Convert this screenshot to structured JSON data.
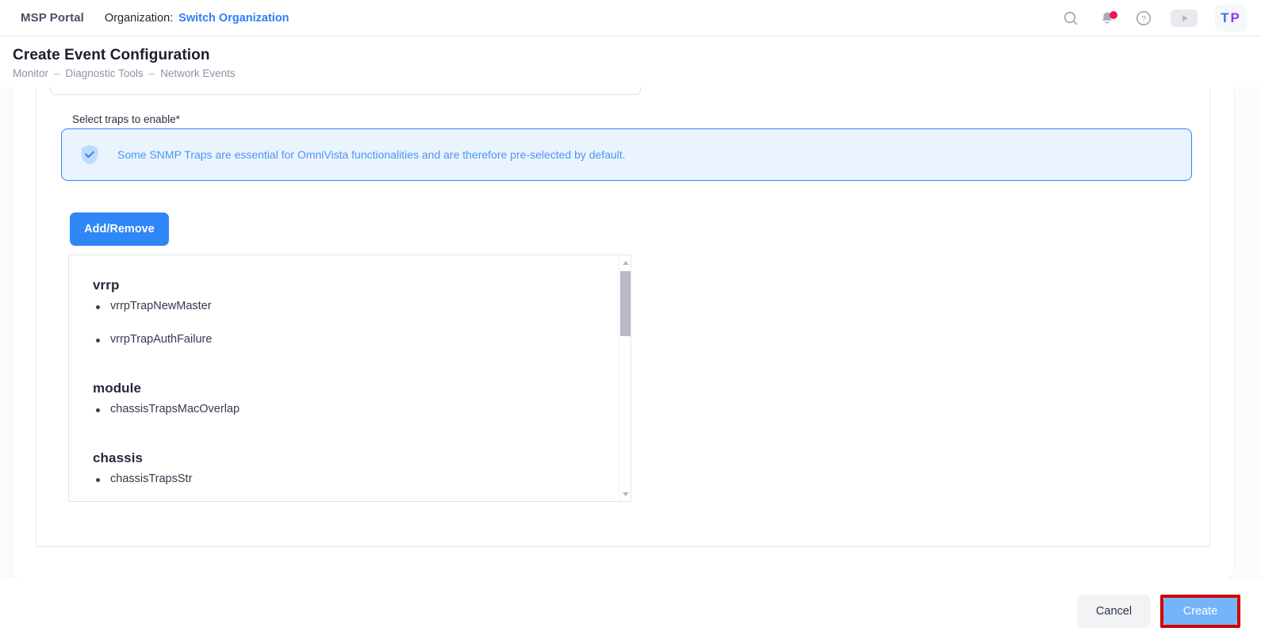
{
  "topbar": {
    "msp_portal": "MSP Portal",
    "organization_label": "Organization:",
    "switch_organization": "Switch Organization",
    "icons": {
      "search": "search-icon",
      "notifications": "bell-icon",
      "help": "help-circle-icon",
      "media": "play-icon"
    },
    "avatar": {
      "initial_1": "T",
      "initial_2": "P"
    }
  },
  "header": {
    "title": "Create Event Configuration",
    "breadcrumb": [
      {
        "label": "Monitor"
      },
      {
        "label": "Diagnostic Tools"
      },
      {
        "label": "Network Events"
      }
    ],
    "separator": "–"
  },
  "form": {
    "select_traps_label": "Select traps to enable*",
    "info_banner": {
      "icon": "shield-check-icon",
      "message": "Some SNMP Traps are essential for OmniVista functionalities and are therefore pre-selected by default."
    },
    "add_remove_label": "Add/Remove",
    "trap_groups": [
      {
        "name": "vrrp",
        "traps": [
          "vrrpTrapNewMaster",
          "vrrpTrapAuthFailure"
        ]
      },
      {
        "name": "module",
        "traps": [
          "chassisTrapsMacOverlap"
        ]
      },
      {
        "name": "chassis",
        "traps": [
          "chassisTrapsStr"
        ]
      }
    ]
  },
  "footer": {
    "cancel_label": "Cancel",
    "create_label": "Create"
  },
  "colors": {
    "accent_blue": "#2f86f7",
    "link_blue": "#2f7df6",
    "info_bg": "#eaf4fe",
    "info_border": "#2f86f0",
    "highlight_red": "#d00000",
    "badge_red": "#f5164a"
  }
}
